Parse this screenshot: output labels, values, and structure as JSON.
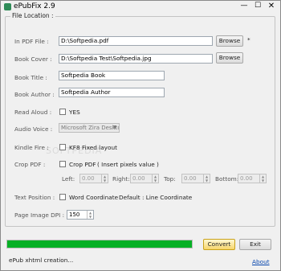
{
  "window": {
    "title": "ePubFix 2.9",
    "minimize": "—",
    "maximize": "☐",
    "close": "✕"
  },
  "group": {
    "title": "File Location :"
  },
  "pdf_file": {
    "label": "In PDF File :",
    "value": "D:\\Softpedia.pdf",
    "browse": "Browse",
    "marker": "*"
  },
  "book_cover": {
    "label": "Book Cover :",
    "value": "D:\\Softpedia Test\\Softpedia.jpg",
    "browse": "Browse"
  },
  "book_title": {
    "label": "Book Title :",
    "value": "Softpedia Book"
  },
  "book_author": {
    "label": "Book Author :",
    "value": "Softpedia Author"
  },
  "read_aloud": {
    "label": "Read Aloud :",
    "option": "YES",
    "checked": false
  },
  "audio_voice": {
    "label": "Audio Voice :",
    "value": "Microsoft Zira Deskto"
  },
  "kindle_fire": {
    "label": "Kindle Fire :",
    "option": "KF8 Fixed layout",
    "checked": false
  },
  "crop_pdf": {
    "label": "Crop PDF :",
    "option": "Crop PDF",
    "hint": "( Insert pixels value )",
    "checked": false,
    "left_label": "Left:",
    "left_value": "0.00",
    "right_label": "Right:",
    "right_value": "0.00",
    "top_label": "Top:",
    "top_value": "0.00",
    "bottom_label": "Bottom:",
    "bottom_value": "0.00"
  },
  "text_position": {
    "label": "Text Position :",
    "option": "Word Coordinate",
    "checked": false,
    "default_text": "Default : Line Coordinate"
  },
  "page_image_dpi": {
    "label": "Page Image DPI :",
    "value": "150"
  },
  "progress": {
    "percent": 100,
    "color": "#06b025"
  },
  "actions": {
    "convert": "Convert",
    "exit": "Exit",
    "about": "About"
  },
  "status": {
    "text": "ePub xhtml creation..."
  },
  "watermark": "SOFTPEDIA"
}
